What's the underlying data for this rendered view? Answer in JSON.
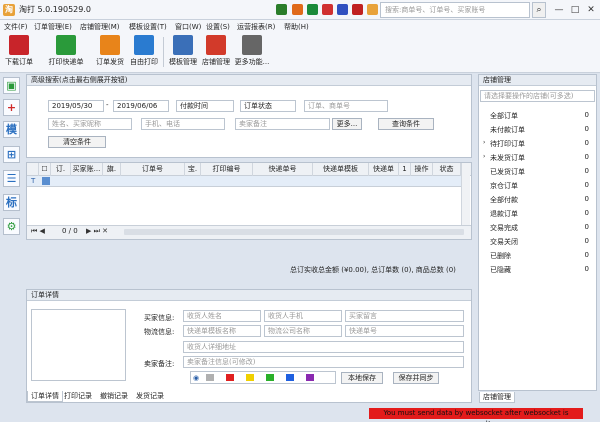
{
  "app": {
    "title": "淘打 5.0.190529.0",
    "logo_char": "淘"
  },
  "titlebar": {
    "search_placeholder": "搜索:商单号、订单号、买家账号",
    "colors": [
      "#2a7d2a",
      "#e06a1a",
      "#1a8a3a",
      "#d03030",
      "#3050c0",
      "#c02020"
    ]
  },
  "menu": [
    {
      "label": "文件(F)"
    },
    {
      "label": "订单管理(E)"
    },
    {
      "label": "店铺管理(M)"
    },
    {
      "label": "模板设置(T)"
    },
    {
      "label": "窗口(W)"
    },
    {
      "label": "设置(S)"
    },
    {
      "label": "运营报表(R)"
    },
    {
      "label": "帮助(H)"
    }
  ],
  "toolbar": [
    {
      "label": "下载订单",
      "icon": "download-icon",
      "color": "#c8242a"
    },
    {
      "label": "打印快递单",
      "icon": "printer-icon",
      "color": "#2a9a3a"
    },
    {
      "label": "订单发货",
      "icon": "truck-icon",
      "color": "#e8841a"
    },
    {
      "label": "自由打印",
      "icon": "paper-plane-icon",
      "color": "#2a7bd0"
    },
    {
      "label": "模板管理",
      "icon": "template-icon",
      "color": "#3a6fb8"
    },
    {
      "label": "店铺管理",
      "icon": "store-icon",
      "color": "#d23a2a"
    },
    {
      "label": "更多功能...",
      "icon": "grid-icon",
      "color": "#666666"
    }
  ],
  "left_tools": [
    {
      "label": "",
      "icon": "add-icon",
      "color": "#2a9a3a"
    },
    {
      "label": "",
      "icon": "plus-icon",
      "color": "#d02a2a"
    },
    {
      "label": "模",
      "icon": "template-icon",
      "color": "#2a6fc0"
    },
    {
      "label": "",
      "icon": "expand-icon",
      "color": "#2a6fc0"
    },
    {
      "label": "",
      "icon": "archive-icon",
      "color": "#2a6fc0"
    },
    {
      "label": "标",
      "icon": "tag-icon",
      "color": "#2a6fc0"
    },
    {
      "label": "",
      "icon": "gear-icon",
      "color": "#2a9a3a"
    }
  ],
  "search": {
    "header": "高级搜索(点击最右侧展开按钮)",
    "date_from": "2019/05/30",
    "date_to": "2019/06/06",
    "time_type": "付款时间",
    "order_status": "订单状态",
    "ph_order": "订单、商单号",
    "ph_name": "姓名、买家昵称",
    "ph_phone": "手机、电话",
    "ph_note": "卖家备注",
    "more_btn": "更多...",
    "query_btn": "查询条件",
    "clear_btn": "清空条件"
  },
  "grid": {
    "columns": [
      "",
      "订.",
      "买家账...",
      "旗.",
      "订单号",
      "宝.",
      "打印编号",
      "快递单号",
      "快递单模板",
      "快递单",
      "1",
      "操作",
      "状态"
    ],
    "pager": "0 / 0",
    "summary": "总订实收总金额 (¥0.00),  总订单数 (0),  商品总数 (0)"
  },
  "detail": {
    "header": "订单详情",
    "buyer_label": "买家信息:",
    "logistics_label": "物流信息:",
    "note_label": "卖家备注:",
    "ph_buyer_name": "收货人姓名",
    "ph_buyer_phone": "收货人手机",
    "ph_buyer_msg": "买家留言",
    "ph_tpl": "快递单模板名称",
    "ph_company": "物流公司名称",
    "ph_tracking": "快递单号",
    "ph_address": "收货人详细地址",
    "ph_note": "卖家备注信息(可修改)",
    "save_note_btn": "本地保存",
    "save_sync_btn": "保存并同步",
    "flag_colors": [
      "#b0b0b0",
      "#e02020",
      "#f0d000",
      "#2ab02a",
      "#2060e0",
      "#8a2ab0"
    ],
    "tabs": [
      "订单详情",
      "打印记录",
      "撤销记录",
      "发货记录"
    ]
  },
  "store": {
    "header": "店铺管理",
    "select_placeholder": "请选择要操作的店铺(可多选)",
    "items": [
      {
        "label": "全部订单",
        "count": "0"
      },
      {
        "label": "未付款订单",
        "count": "0"
      },
      {
        "label": "待打印订单",
        "count": "0"
      },
      {
        "label": "未发货订单",
        "count": "0"
      },
      {
        "label": "已发货订单",
        "count": "0"
      },
      {
        "label": "京仓订单",
        "count": "0"
      },
      {
        "label": "全部付款",
        "count": "0"
      },
      {
        "label": "退款订单",
        "count": "0"
      },
      {
        "label": "交易完成",
        "count": "0"
      },
      {
        "label": "交易关闭",
        "count": "0"
      },
      {
        "label": "已删除",
        "count": "0"
      },
      {
        "label": "已隐藏",
        "count": "0"
      }
    ],
    "tab": "店铺管理"
  },
  "status": {
    "error": "You must send data by websocket after websocket is opened!"
  }
}
